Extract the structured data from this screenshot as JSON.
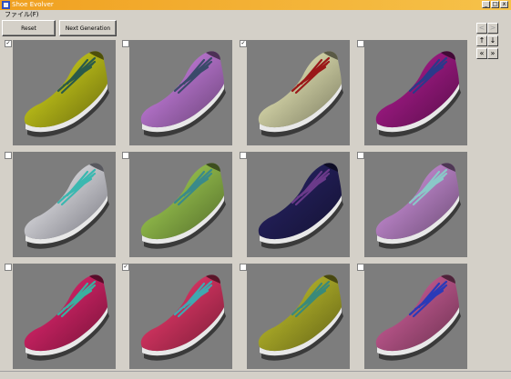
{
  "window": {
    "title": "Shoe Evolver",
    "controls": [
      "_",
      "□",
      "x"
    ]
  },
  "menu": {
    "file": "ファイル(F)"
  },
  "toolbar": {
    "reset": "Reset",
    "next": "Next Generation"
  },
  "nav": [
    "<",
    ">",
    "↑",
    "↓",
    "«",
    "»"
  ],
  "shoes": [
    {
      "checked": true,
      "color": "#c4c61a",
      "lace": "#2a5a4a"
    },
    {
      "checked": false,
      "color": "#c07ad8",
      "lace": "#3a4a6a"
    },
    {
      "checked": true,
      "color": "#e2e2b0",
      "lace": "#9a1818"
    },
    {
      "checked": false,
      "color": "#a21a86",
      "lace": "#2a3a8a"
    },
    {
      "checked": false,
      "color": "#dcdcec",
      "lace": "#3ab8b0"
    },
    {
      "checked": false,
      "color": "#98c44e",
      "lace": "#3a8a8a"
    },
    {
      "checked": false,
      "color": "#24205c",
      "lace": "#6a3a8a"
    },
    {
      "checked": false,
      "color": "#c48ad2",
      "lace": "#8ac8c8"
    },
    {
      "checked": false,
      "color": "#d62468",
      "lace": "#3ab0a0"
    },
    {
      "checked": true,
      "color": "#e03666",
      "lace": "#40a8b0"
    },
    {
      "checked": false,
      "color": "#b4b42a",
      "lace": "#3a8a7a"
    },
    {
      "checked": false,
      "color": "#c45a92",
      "lace": "#2a3ab8"
    }
  ]
}
